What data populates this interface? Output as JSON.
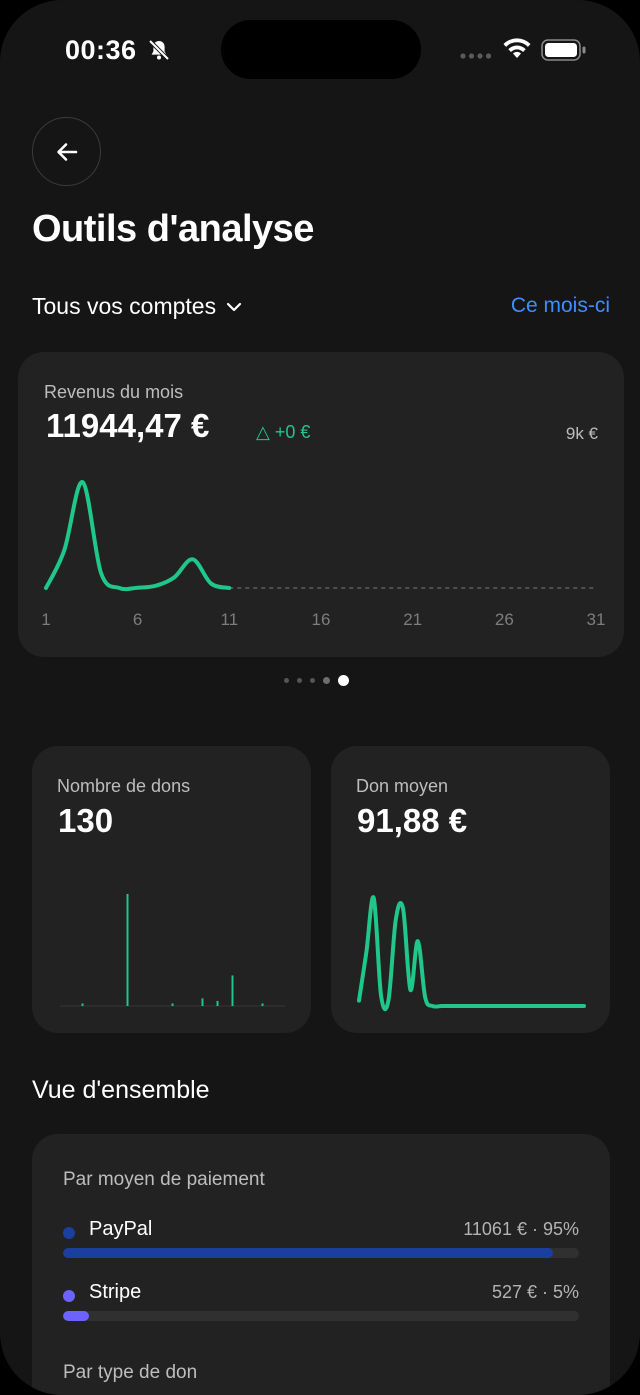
{
  "status": {
    "time": "00:36"
  },
  "header": {
    "title": "Outils d'analyse"
  },
  "filters": {
    "account": "Tous vos comptes",
    "period": "Ce mois-ci"
  },
  "revenue": {
    "label": "Revenus du mois",
    "value": "11944,47 €",
    "delta": "△ +0 €",
    "scale": "9k €",
    "x_ticks": [
      "1",
      "6",
      "11",
      "16",
      "21",
      "26",
      "31"
    ]
  },
  "chart_data": [
    {
      "type": "line",
      "title": "Revenus du mois",
      "x": [
        1,
        2,
        3,
        4,
        5,
        6,
        7,
        8,
        9,
        10,
        11
      ],
      "values": [
        0,
        2500,
        7000,
        1000,
        0,
        20,
        150,
        700,
        1900,
        300,
        0
      ],
      "projection_to": 31,
      "ylim": [
        0,
        9000
      ],
      "color": "#1fc78a"
    },
    {
      "type": "bar",
      "title": "Nombre de dons",
      "values": [
        0,
        0,
        0,
        1,
        0,
        0,
        0,
        0,
        0,
        44,
        0,
        0,
        0,
        0,
        0,
        1,
        0,
        0,
        0,
        3,
        0,
        2,
        0,
        12,
        0,
        0,
        0,
        1,
        0,
        0,
        0
      ],
      "color": "#1fc78a"
    },
    {
      "type": "line",
      "title": "Don moyen",
      "values": [
        5,
        50,
        100,
        10,
        5,
        80,
        90,
        15,
        60,
        8,
        0,
        0,
        0,
        0,
        0,
        0,
        0,
        0,
        0,
        0,
        0,
        0,
        0,
        0,
        0,
        0,
        0,
        0,
        0,
        0,
        0
      ],
      "color": "#1fc78a"
    }
  ],
  "cards": {
    "count": {
      "label": "Nombre de dons",
      "value": "130"
    },
    "average": {
      "label": "Don moyen",
      "value": "91,88 €"
    }
  },
  "overview": {
    "title": "Vue d'ensemble",
    "payment_label": "Par moyen de paiement",
    "methods": [
      {
        "name": "PayPal",
        "value": "11061 € · 95%",
        "share": 0.95,
        "color": "#1b3f9e"
      },
      {
        "name": "Stripe",
        "value": "527 € · 5%",
        "share": 0.05,
        "color": "#6c63ff"
      }
    ],
    "type_label": "Par type de don"
  }
}
